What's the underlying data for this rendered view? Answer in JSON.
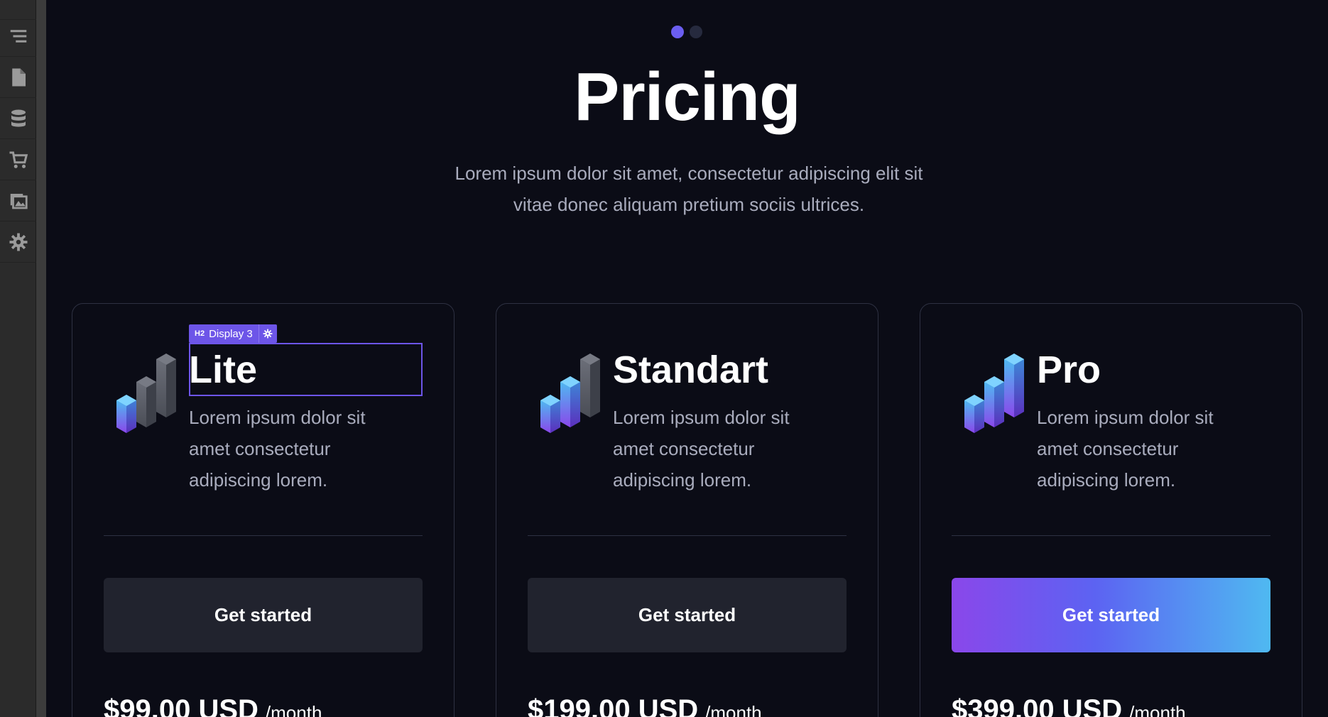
{
  "sidebar": {
    "items": [
      {
        "icon": "box-icon"
      },
      {
        "icon": "navigator-icon"
      },
      {
        "icon": "pages-icon"
      },
      {
        "icon": "cms-database-icon"
      },
      {
        "icon": "ecommerce-cart-icon"
      },
      {
        "icon": "assets-icon"
      },
      {
        "icon": "settings-gear-icon"
      }
    ]
  },
  "carousel": {
    "total": 2,
    "active": 1
  },
  "header": {
    "title": "Pricing",
    "subtitle": "Lorem ipsum dolor sit amet, consectetur adipiscing elit sit vitae donec aliquam pretium sociis ultrices."
  },
  "selection": {
    "tag": "H2",
    "label": "Display 3"
  },
  "plans": [
    {
      "name": "Lite",
      "description": "Lorem ipsum dolor sit amet consectetur adipiscing lorem.",
      "button": "Get started",
      "price": "$99.00 USD",
      "period": "/month"
    },
    {
      "name": "Standart",
      "description": "Lorem ipsum dolor sit amet consectetur adipiscing lorem.",
      "button": "Get started",
      "price": "$199.00 USD",
      "period": "/month"
    },
    {
      "name": "Pro",
      "description": "Lorem ipsum dolor sit amet consectetur adipiscing lorem.",
      "button": "Get started",
      "price": "$399.00 USD",
      "period": "/month"
    }
  ],
  "colors": {
    "background": "#0b0c16",
    "accent": "#6b5ef0",
    "selection": "#6d55e8",
    "gradient_start": "#8a47ea",
    "gradient_end": "#4fb9f1"
  }
}
